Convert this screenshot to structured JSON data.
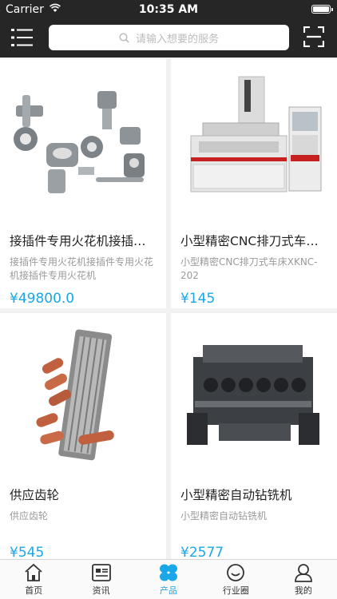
{
  "status_bar": {
    "carrier": "Carrier",
    "time": "10:35 AM"
  },
  "header": {
    "search_placeholder": "请输入想要的服务"
  },
  "products": [
    {
      "title": "接插件专用火花机接插…",
      "desc": "接插件专用火花机接插件专用火花机接插件专用火花机",
      "price": "¥49800.0"
    },
    {
      "title": "小型精密CNC排刀式车…",
      "desc": "小型精密CNC排刀式车床XKNC-202",
      "price": "¥145"
    },
    {
      "title": "供应齿轮",
      "desc": "供应齿轮",
      "price": "¥545"
    },
    {
      "title": "小型精密自动钻铣机",
      "desc": "小型精密自动钻铣机",
      "price": "¥2577"
    }
  ],
  "tabs": [
    {
      "label": "首页",
      "icon": "home-icon"
    },
    {
      "label": "资讯",
      "icon": "news-icon"
    },
    {
      "label": "产品",
      "icon": "product-icon",
      "active": true
    },
    {
      "label": "行业圈",
      "icon": "circle-icon"
    },
    {
      "label": "我的",
      "icon": "user-icon"
    }
  ],
  "colors": {
    "accent": "#1aa7e8",
    "header_bg": "#262626"
  }
}
